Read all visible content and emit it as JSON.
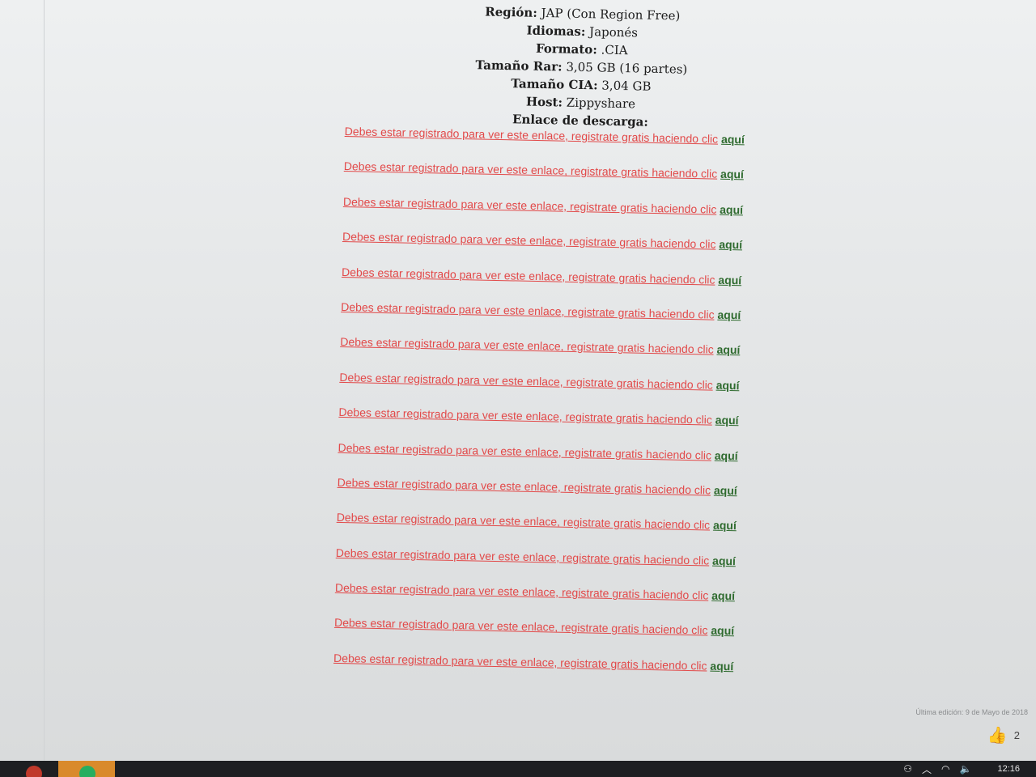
{
  "info": [
    {
      "key": "Región:",
      "value": "JAP (Con Region Free)"
    },
    {
      "key": "Idiomas:",
      "value": "Japonés"
    },
    {
      "key": "Formato:",
      "value": ".CIA"
    },
    {
      "key": "Tamaño Rar:",
      "value": "3,05 GB (16 partes)"
    },
    {
      "key": "Tamaño CIA:",
      "value": "3,04 GB"
    },
    {
      "key": "Host:",
      "value": "Zippyshare"
    },
    {
      "key": "Enlace de descarga:",
      "value": ""
    }
  ],
  "download_links": {
    "text": "Debes estar registrado para ver este enlace, registrate gratis haciendo clic",
    "link": "aquí",
    "count": 16
  },
  "footer": {
    "last_edit": "Última edición: 9 de Mayo de 2018",
    "like_count": "2"
  },
  "taskbar": {
    "clock": "12:16",
    "colors": {
      "app1": "#c0392b",
      "app2": "#27ae60"
    }
  },
  "icons": [
    "thumbs-up-icon",
    "people-icon",
    "chevron-up-icon",
    "wifi-icon",
    "volume-icon",
    "mouse-cursor-icon"
  ]
}
